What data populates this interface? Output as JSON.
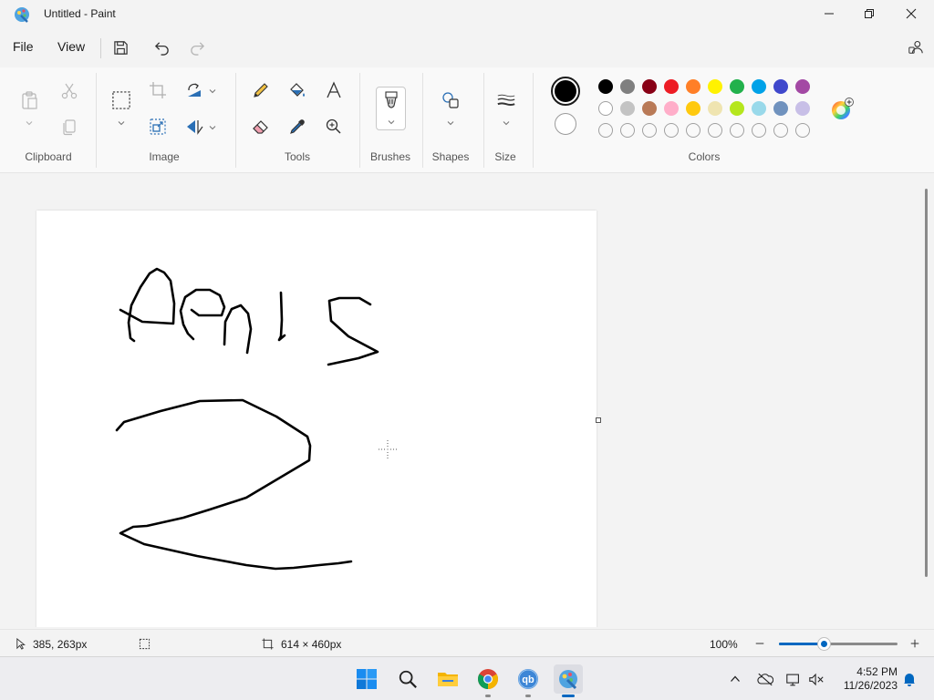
{
  "window": {
    "title": "Untitled - Paint"
  },
  "menu": {
    "file": "File",
    "view": "View"
  },
  "ribbon": {
    "groups": {
      "clipboard": "Clipboard",
      "image": "Image",
      "tools": "Tools",
      "brushes": "Brushes",
      "shapes": "Shapes",
      "size": "Size",
      "colors": "Colors"
    },
    "primary_color": "#000000",
    "secondary_color": "#ffffff",
    "palette_row1": [
      "#000000",
      "#7f7f7f",
      "#880015",
      "#ed1c24",
      "#ff7f27",
      "#fff200",
      "#22b14c",
      "#00a2e8",
      "#3f48cc",
      "#a349a4"
    ],
    "palette_row2": [
      "#ffffff",
      "#c3c3c3",
      "#b97a57",
      "#ffaec9",
      "#ffc90e",
      "#efe4b0",
      "#b5e61d",
      "#99d9ea",
      "#7092be",
      "#c8bfe7"
    ],
    "palette_row3_count": 10
  },
  "status": {
    "cursor_position": "385, 263px",
    "canvas_size": "614 × 460px",
    "zoom": "100%"
  },
  "taskbar": {
    "time": "4:52 PM",
    "date": "11/26/2023"
  },
  "colors": {
    "accent": "#0067c0"
  }
}
